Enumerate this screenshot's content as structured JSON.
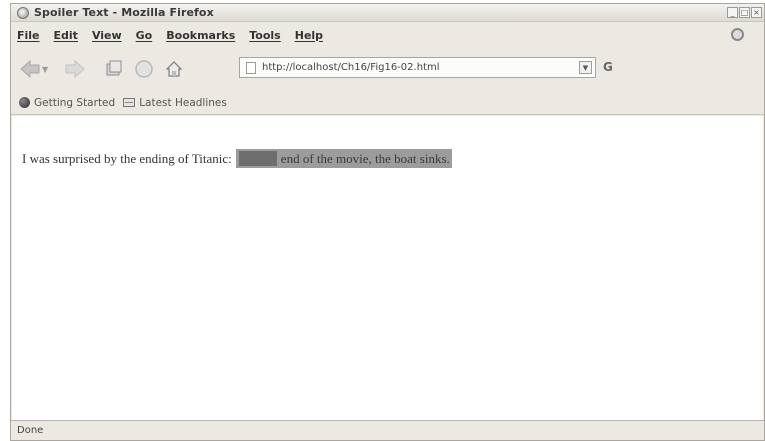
{
  "window": {
    "title": "Spoiler Text - Mozilla Firefox",
    "controls": [
      "_",
      "□",
      "×"
    ]
  },
  "menu": {
    "items": [
      "File",
      "Edit",
      "View",
      "Go",
      "Bookmarks",
      "Tools",
      "Help"
    ]
  },
  "navigation": {
    "url": "http://localhost/Ch16/Fig16-02.html",
    "icons": [
      "back-icon",
      "forward-icon",
      "reload-icon",
      "stop-icon",
      "home-icon",
      "page-icon",
      "go-icon"
    ]
  },
  "bookmarks": {
    "items": [
      "Getting Started",
      "Latest Headlines"
    ]
  },
  "content": {
    "sentence": "I was surprised by the ending of Titanic:",
    "spoiler_text": "end of the movie, the boat sinks."
  },
  "status": {
    "text": "Done"
  },
  "colors": {
    "chrome": "#ece9e2",
    "spoiler_background": "#9c9c9c"
  }
}
